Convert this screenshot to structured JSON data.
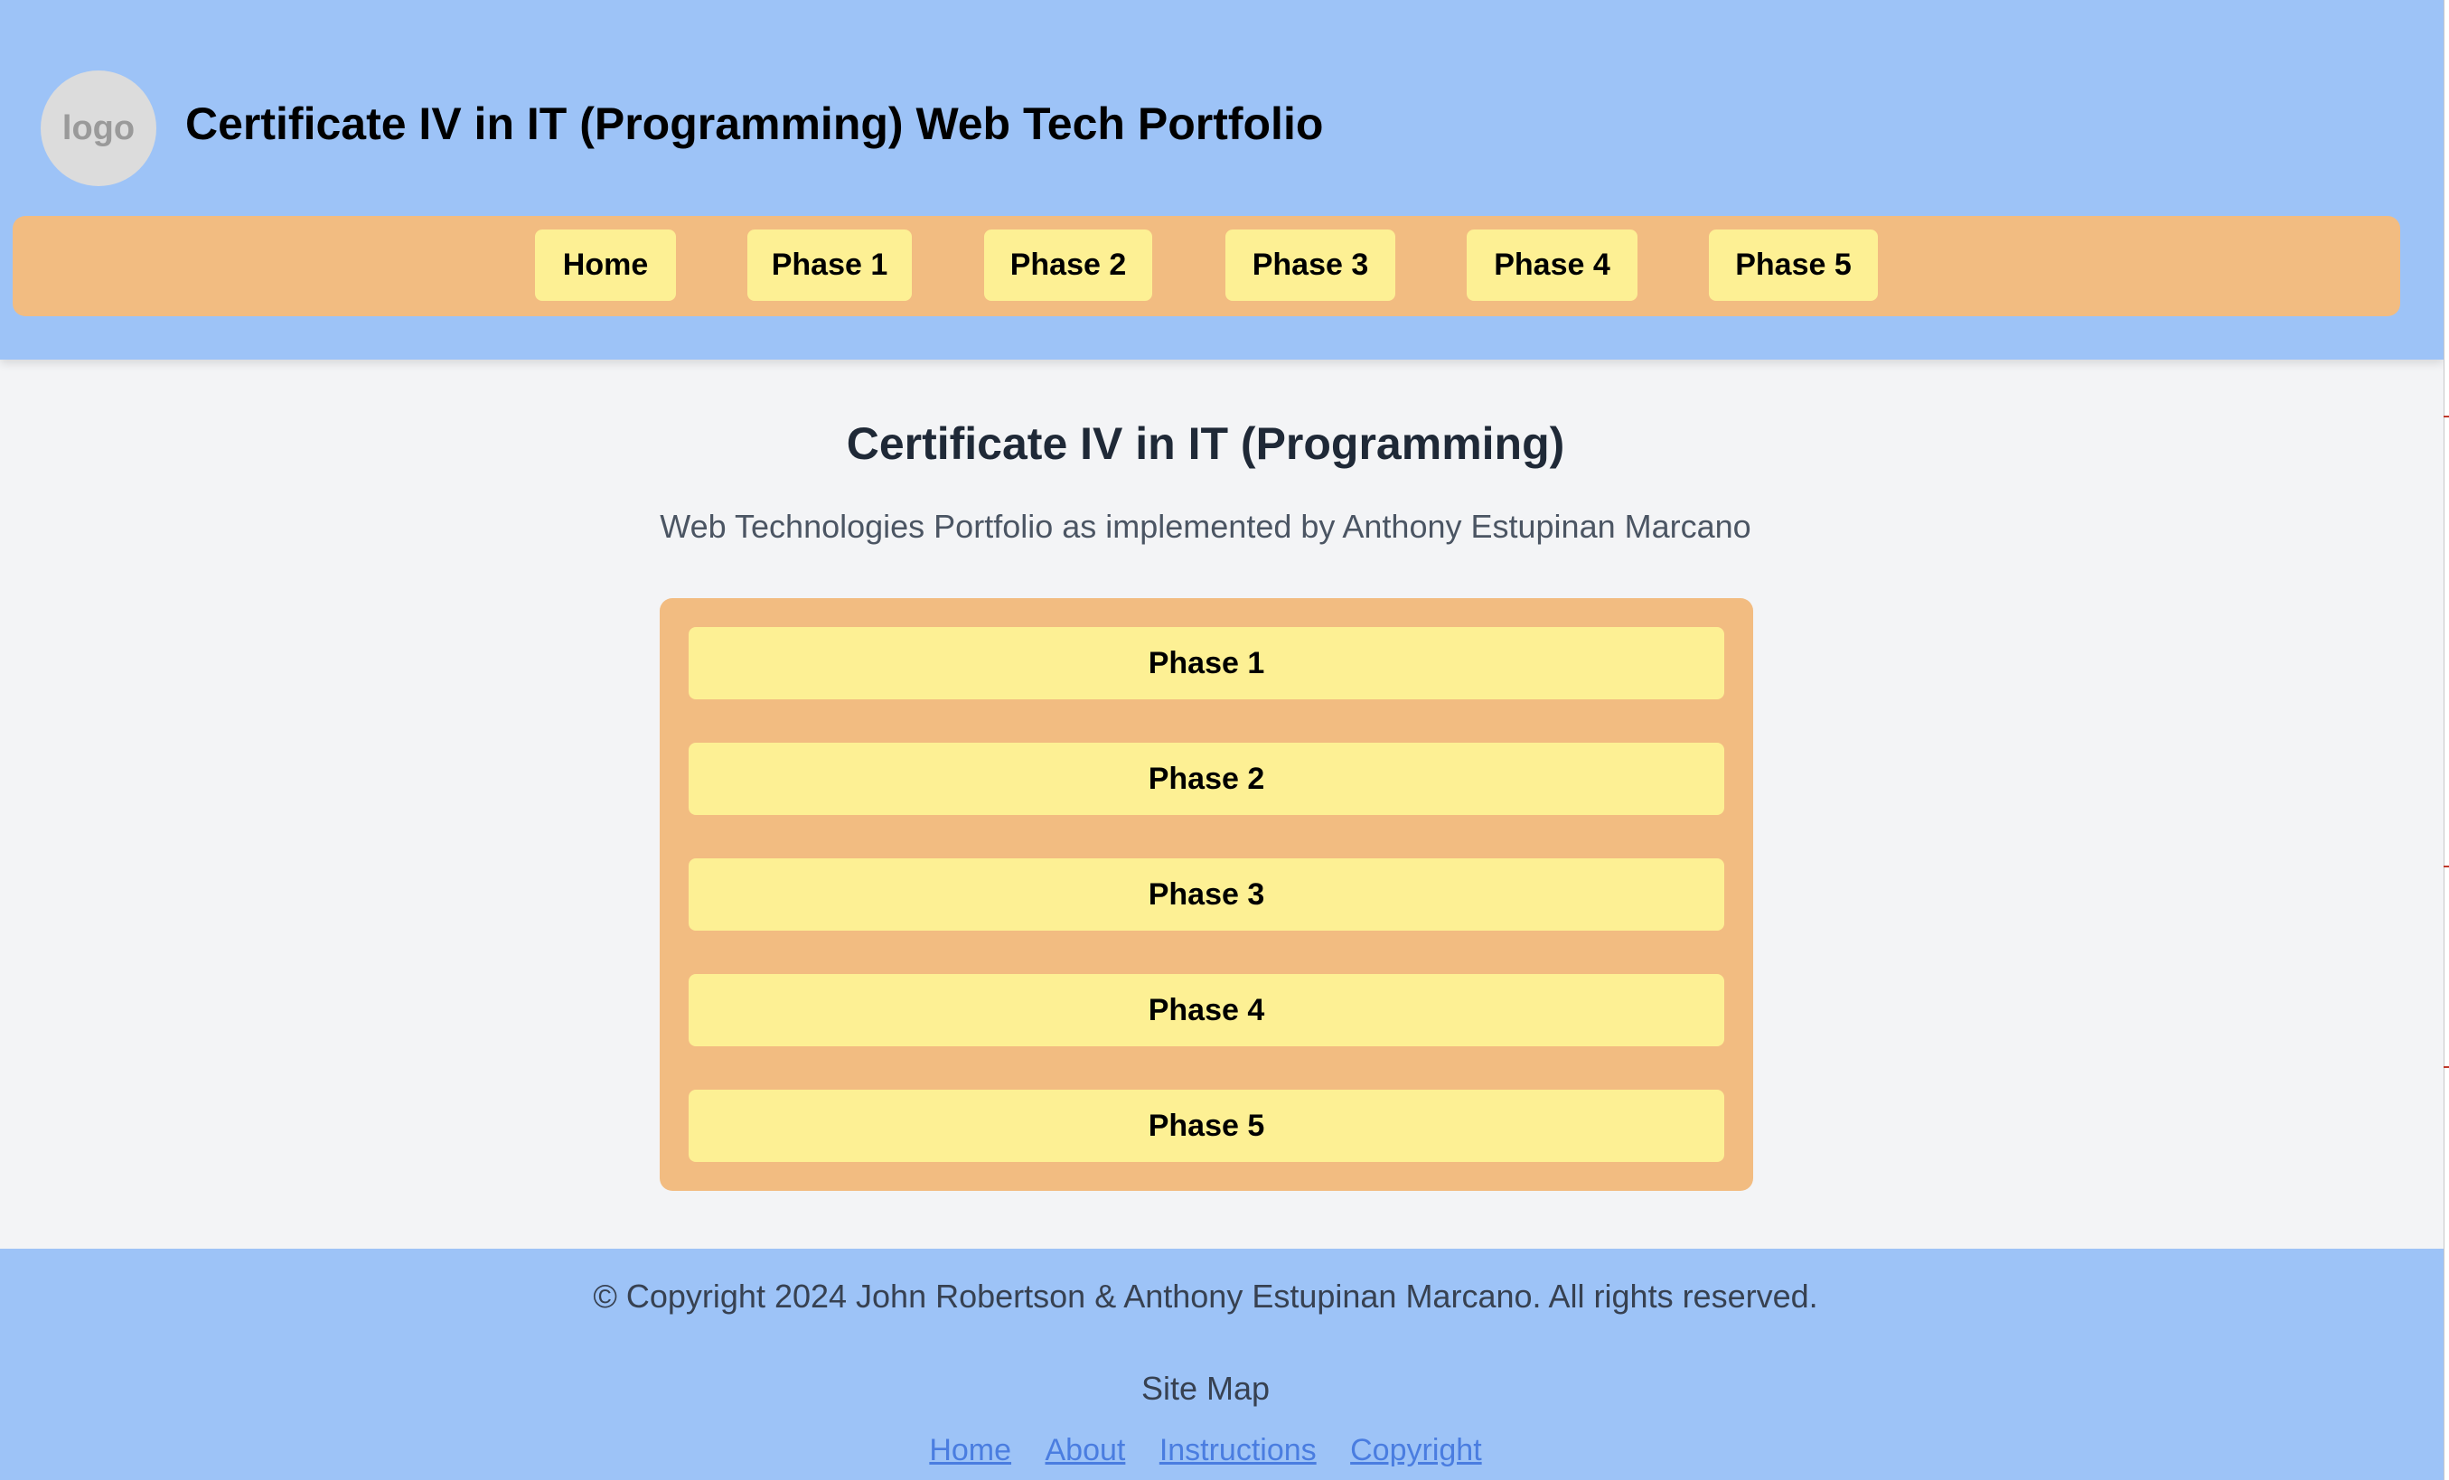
{
  "header": {
    "logo_text": "logo",
    "site_title": "Certificate IV in IT (Programming) Web Tech Portfolio"
  },
  "nav": {
    "items": [
      {
        "label": "Home"
      },
      {
        "label": "Phase 1"
      },
      {
        "label": "Phase 2"
      },
      {
        "label": "Phase 3"
      },
      {
        "label": "Phase 4"
      },
      {
        "label": "Phase 5"
      }
    ]
  },
  "main": {
    "title": "Certificate IV in IT (Programming)",
    "subtitle": "Web Technologies Portfolio as implemented by Anthony Estupinan Marcano",
    "phases": [
      {
        "label": "Phase 1"
      },
      {
        "label": "Phase 2"
      },
      {
        "label": "Phase 3"
      },
      {
        "label": "Phase 4"
      },
      {
        "label": "Phase 5"
      }
    ]
  },
  "footer": {
    "copyright": "© Copyright 2024 John Robertson & Anthony Estupinan Marcano. All rights reserved.",
    "sitemap_title": "Site Map",
    "links": [
      {
        "label": "Home"
      },
      {
        "label": "About"
      },
      {
        "label": "Instructions"
      },
      {
        "label": "Copyright"
      }
    ]
  },
  "colors": {
    "header_bg": "#9dc3f7",
    "nav_bg": "#f2bc81",
    "button_bg": "#fdf094",
    "page_bg": "#f3f4f6",
    "link": "#4a7de0"
  }
}
